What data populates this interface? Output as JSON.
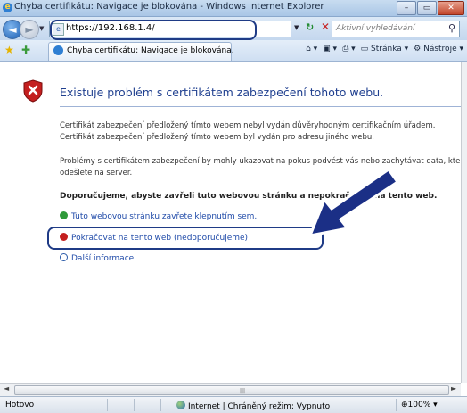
{
  "window": {
    "title": "Chyba certifikátu: Navigace je blokována - Windows Internet Explorer",
    "buttons": [
      "–",
      "▭",
      "✕"
    ]
  },
  "address": {
    "url": "https://192.168.1.4/",
    "search_placeholder": "Aktivní vyhledávání"
  },
  "tab": {
    "label": "Chyba certifikátu: Navigace je blokována."
  },
  "toolbar": {
    "page_label": "Stránka",
    "tools_label": "Nástroje"
  },
  "page": {
    "heading": "Existuje problém s certifikátem zabezpečení tohoto webu.",
    "para1_line1": "Certifikát zabezpečení předložený tímto webem nebyl vydán důvěryhodným certifikačním úřadem.",
    "para1_line2": "Certifikát zabezpečení předložený tímto webem byl vydán pro adresu jiného webu.",
    "para2_line1": "Problémy s certifikátem zabezpečení by mohly ukazovat na pokus podvést vás nebo zachytávat data, která",
    "para2_line2": "odešlete na server.",
    "recommend": "Doporučujeme, abyste zavřeli tuto webovou stránku a nepokračovali na tento web.",
    "close_link": "Tuto webovou stránku zavřete klepnutím sem.",
    "continue_link": "Pokračovat na tento web (nedoporučujeme)",
    "more_info": "Další informace"
  },
  "status": {
    "text": "Hotovo",
    "zone": "Internet | Chráněný režim: Vypnuto",
    "zoom": "100%"
  },
  "colors": {
    "accent": "#1f3b86",
    "link": "#1f4aa8",
    "heading": "#1f3f8f"
  }
}
